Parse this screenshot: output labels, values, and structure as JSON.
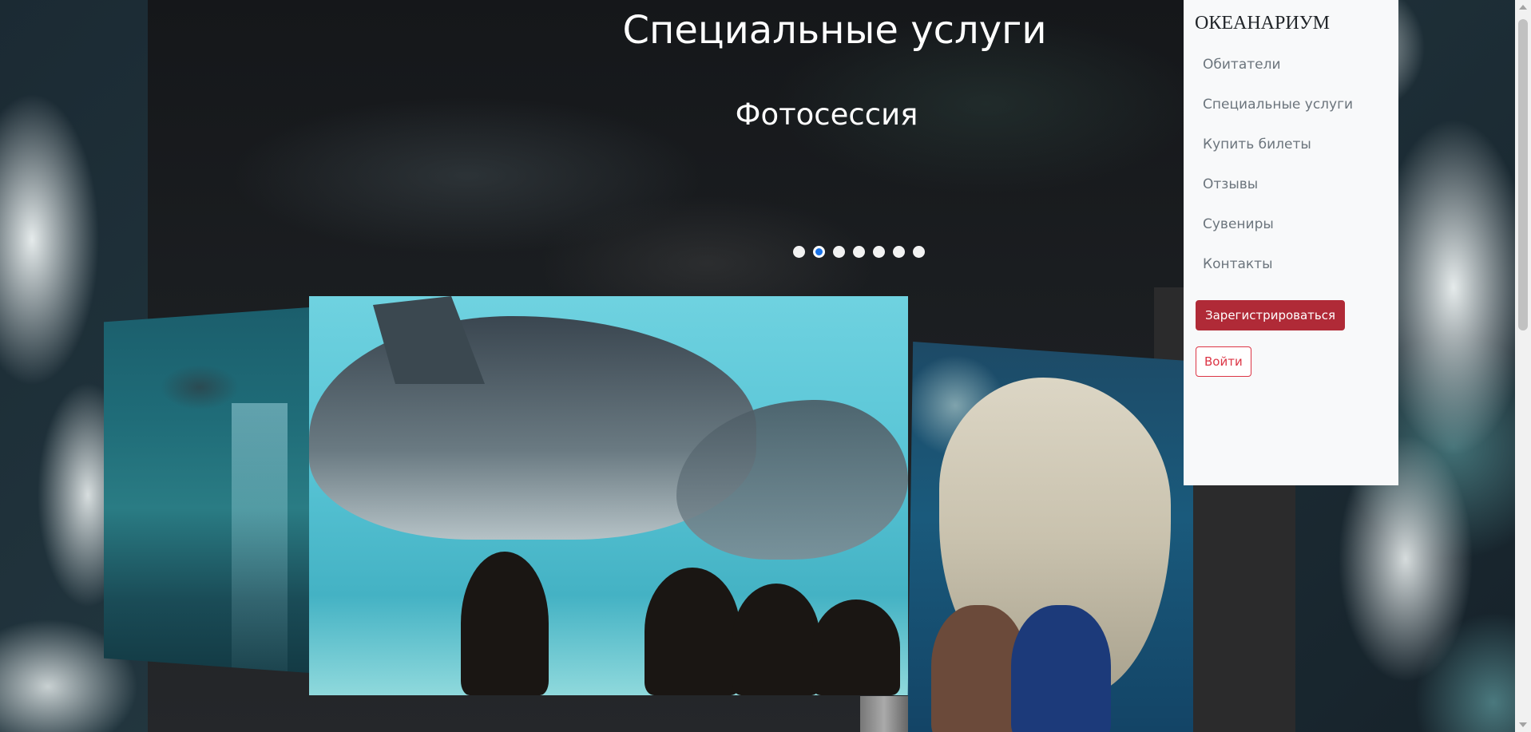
{
  "section": {
    "title": "Специальные услуги",
    "caption": "Фотосессия"
  },
  "carousel": {
    "total_indicators": 7,
    "active_index": 1,
    "slides": [
      {
        "subject": "stingray"
      },
      {
        "subject": "dolphins"
      },
      {
        "subject": "polar-bear"
      }
    ]
  },
  "sidebar": {
    "brand": "ОКЕАНАРИУМ",
    "items": [
      {
        "label": "Обитатели"
      },
      {
        "label": "Специальные услуги"
      },
      {
        "label": "Купить билеты"
      },
      {
        "label": "Отзывы"
      },
      {
        "label": "Сувениры"
      },
      {
        "label": "Контакты"
      }
    ],
    "register_label": "Зарегистрироваться",
    "login_label": "Войти"
  },
  "colors": {
    "register_bg": "#b02a37",
    "login_border": "#dc3545",
    "active_indicator": "#1a73e8",
    "sidebar_bg": "#f8f9fa"
  }
}
